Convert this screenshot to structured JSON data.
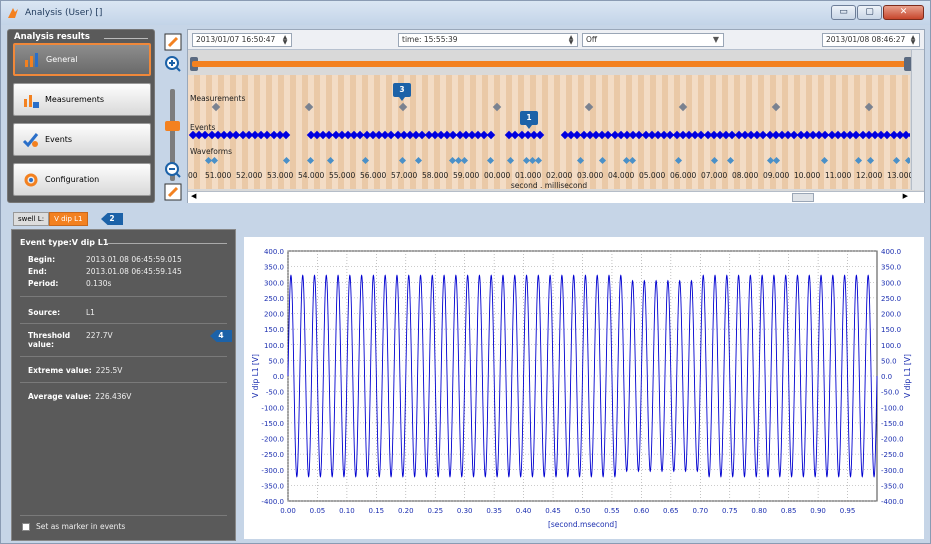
{
  "window": {
    "title": "Analysis (User) []",
    "min": "▭",
    "max": "▢",
    "close": "✕"
  },
  "nav": {
    "legend": "Analysis results",
    "items": [
      {
        "label": "General",
        "icon": "chart-icon",
        "selected": true
      },
      {
        "label": "Measurements",
        "icon": "measurements-icon",
        "selected": false
      },
      {
        "label": "Events",
        "icon": "events-icon",
        "selected": false
      },
      {
        "label": "Configuration",
        "icon": "configuration-icon",
        "selected": false
      }
    ]
  },
  "timeline": {
    "start": "2013/01/07 16:50:47",
    "time": "time: 15:55:39",
    "filter": "Off",
    "end": "2013/01/08 08:46:27",
    "row_labels": [
      "Measurements",
      "Events",
      "Waveforms"
    ],
    "flag3": "3",
    "flag1": "1",
    "ticks": [
      "00",
      "51.000",
      "52.000",
      "53.000",
      "54.000",
      "55.000",
      "56.000",
      "57.000",
      "58.000",
      "59.000",
      "00.000",
      "01.000",
      "02.000",
      "03.000",
      "04.000",
      "05.000",
      "06.000",
      "07.000",
      "08.000",
      "09.000",
      "10.000",
      "11.000",
      "12.000",
      "13.000"
    ],
    "axis_title": "second . millisecond"
  },
  "tabs": {
    "items": [
      "swell L:",
      "V dip L1"
    ],
    "callout": "2"
  },
  "event": {
    "title": "Event type:V dip L1",
    "begin_label": "Begin:",
    "begin": "2013.01.08 06:45:59.015",
    "end_label": "End:",
    "end": "2013.01.08 06:45:59.145",
    "period_label": "Period:",
    "period": "0.130s",
    "source_label": "Source:",
    "source": "L1",
    "threshold_label": "Threshold value:",
    "threshold": "227.7V",
    "callout": "4",
    "extreme_label": "Extreme value:",
    "extreme": "225.5V",
    "average_label": "Average value:",
    "average": "226.436V",
    "marker_label": "Set as marker in events"
  },
  "chart_data": {
    "type": "line",
    "title": "",
    "xlabel": "[second.msecond]",
    "ylabel": "V dip L1 [V]",
    "ylabel_right": "V dip L1 [V]",
    "xlim": [
      0.0,
      1.0
    ],
    "ylim": [
      -400,
      400
    ],
    "xticks": [
      0.0,
      0.05,
      0.1,
      0.15,
      0.2,
      0.25,
      0.3,
      0.35,
      0.4,
      0.45,
      0.5,
      0.55,
      0.6,
      0.65,
      0.7,
      0.75,
      0.8,
      0.85,
      0.9,
      0.95
    ],
    "xtick_labels": [
      "0.00",
      "0.05",
      "0.10",
      "0.15",
      "0.20",
      "0.25",
      "0.30",
      "0.35",
      "0.40",
      "0.45",
      "0.50",
      "0.55",
      "0.60",
      "0.65",
      "0.70",
      "0.75",
      "0.80",
      "0.85",
      "0.90",
      "0.95"
    ],
    "yticks": [
      400,
      350,
      300,
      250,
      200,
      150,
      100,
      50,
      0,
      -50,
      -100,
      -150,
      -200,
      -250,
      -300,
      -350,
      -400
    ],
    "ytick_labels": [
      "400.0",
      "350.0",
      "300.0",
      "250.0",
      "200.0",
      "150.0",
      "100.0",
      "50.0",
      "0.0",
      "-50.0",
      "-100.0",
      "-150.0",
      "-200.0",
      "-250.0",
      "-300.0",
      "-350.0",
      "-400.0"
    ],
    "grid": true,
    "series": [
      {
        "frequency_hz": 50,
        "amplitude": 322,
        "dip_amplitude": 305,
        "dip_start": 0.57,
        "dip_end": 0.7,
        "color": "#0000d0"
      }
    ]
  }
}
